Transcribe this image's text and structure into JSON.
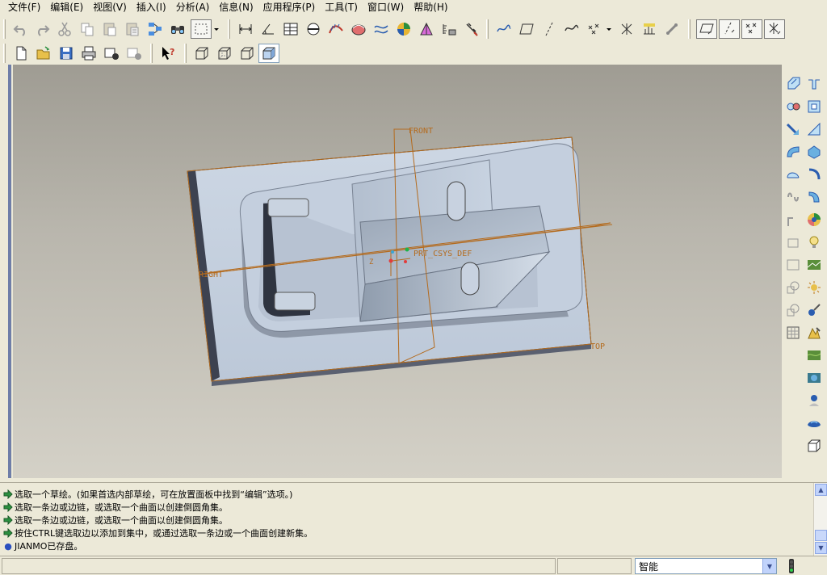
{
  "menubar": {
    "items": [
      "文件(F)",
      "编辑(E)",
      "视图(V)",
      "插入(I)",
      "分析(A)",
      "信息(N)",
      "应用程序(P)",
      "工具(T)",
      "窗口(W)",
      "帮助(H)"
    ]
  },
  "toolbar1": {
    "icons": [
      "undo-icon",
      "redo-icon",
      "cut-icon",
      "copy-icon",
      "paste-icon",
      "paste-special-icon",
      "regenerate-icon",
      "find-icon",
      "select-box-icon",
      "dimension-icon",
      "angle-measure-icon",
      "table-icon",
      "section-icon",
      "curvature-icon",
      "shaded-curvature-icon",
      "deviation-icon",
      "draft-analysis-icon",
      "slope-icon",
      "reflection-icon",
      "saved-analysis-icon",
      "datum-curve-display-icon",
      "datum-plane-display-icon",
      "datum-axis-display-icon",
      "datum-curve-icon",
      "datum-point-display-icon",
      "datum-csys-display-icon",
      "annotation-display-icon",
      "spin-center-icon",
      "plane-tag-icon",
      "axis-tag-icon",
      "point-tag-icon",
      "csys-tag-icon"
    ]
  },
  "toolbar2": {
    "icons": [
      "new-icon",
      "open-icon",
      "save-icon",
      "print-icon",
      "email-icon",
      "email-link-icon",
      "context-help-icon",
      "wireframe-icon",
      "hidden-line-icon",
      "no-hidden-icon",
      "shading-icon"
    ]
  },
  "model": {
    "datum_labels": {
      "front": "FRONT",
      "right": "RIGHT",
      "top": "TOP",
      "csys": "PRT_CSYS_DEF",
      "z_axis": "Z"
    },
    "colors": {
      "part_face": "#c7d2e0",
      "datum_line": "#b46b1e",
      "background_top": "#9f9c93",
      "background_bottom": "#d4d1c7"
    }
  },
  "right_toolbar": {
    "icons": [
      "datum-plane-icon",
      "datum-axis-icon",
      "datum-point-icon",
      "datum-csys-icon",
      "sketch-icon",
      "analysis-feature-icon",
      "extrude-icon",
      "revolve-icon",
      "sweep-icon",
      "blend-icon",
      "hole-icon",
      "shell-icon",
      "rib-icon",
      "draft-icon",
      "round-icon",
      "chamfer-icon",
      "offset-icon",
      "thicken-icon",
      "copy-feature-icon",
      "pattern-icon",
      "mirror-icon",
      "merge-icon",
      "intersect-icon",
      "appearance-icon",
      "render-light-icon",
      "room-icon",
      "scene-icon",
      "light-editor-icon",
      "spotlight-icon",
      "render-icon",
      "stripe-icon",
      "cube-icon"
    ]
  },
  "messages": [
    {
      "type": "prompt",
      "text": "选取一个草绘。(如果首选内部草绘，可在放置面板中找到“编辑”选项。)"
    },
    {
      "type": "prompt",
      "text": "选取一条边或边链，或选取一个曲面以创建倒圆角集。"
    },
    {
      "type": "prompt",
      "text": "选取一条边或边链，或选取一个曲面以创建倒圆角集。"
    },
    {
      "type": "prompt",
      "text": "按住CTRL键选取边以添加到集中，或通过选取一条边或一个曲面创建新集。"
    },
    {
      "type": "info",
      "text": "JIANMO已存盘。"
    }
  ],
  "statusbar": {
    "filter_value": "智能"
  }
}
